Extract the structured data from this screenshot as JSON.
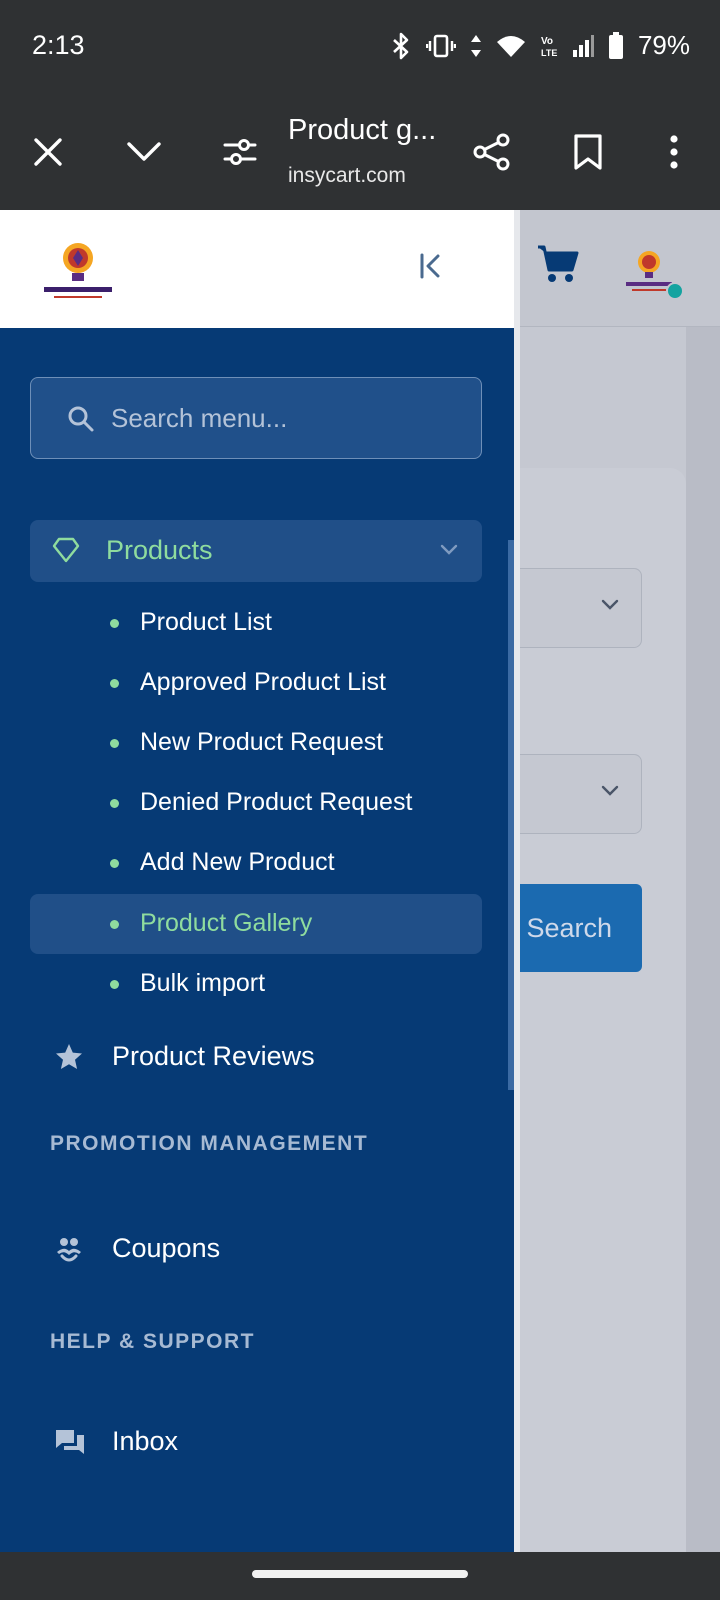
{
  "status_bar": {
    "time": "2:13",
    "battery": "79%",
    "icons": [
      "bluetooth-icon",
      "vibrate-icon",
      "data-arrows-icon",
      "wifi-icon",
      "volte-icon",
      "signal-icon",
      "battery-icon"
    ]
  },
  "browser": {
    "title": "Product g...",
    "url": "insycart.com",
    "actions": [
      "close-icon",
      "chevron-down-icon",
      "tune-icon",
      "share-icon",
      "bookmark-icon",
      "more-vert-icon"
    ]
  },
  "page": {
    "search_button_label": "Search"
  },
  "sidebar": {
    "search_placeholder": "Search menu...",
    "products": {
      "label": "Products",
      "icon": "diamond-icon",
      "items": [
        {
          "label": "Product List",
          "active": false
        },
        {
          "label": "Approved Product List",
          "active": false
        },
        {
          "label": "New Product Request",
          "active": false
        },
        {
          "label": "Denied Product Request",
          "active": false
        },
        {
          "label": "Add New Product",
          "active": false
        },
        {
          "label": "Product Gallery",
          "active": true
        },
        {
          "label": "Bulk import",
          "active": false
        }
      ]
    },
    "product_reviews": {
      "label": "Product Reviews",
      "icon": "star-icon"
    },
    "sections": {
      "promotion": {
        "title": "PROMOTION MANAGEMENT",
        "items": [
          {
            "label": "Coupons",
            "icon": "users-icon"
          }
        ]
      },
      "help": {
        "title": "HELP & SUPPORT",
        "items": [
          {
            "label": "Inbox",
            "icon": "chat-icon"
          }
        ]
      }
    }
  },
  "colors": {
    "sidebar_bg": "#063a75",
    "accent_green": "#8fdc9e",
    "active_bg": "#204f88",
    "primary_button": "#1b6ab0"
  }
}
